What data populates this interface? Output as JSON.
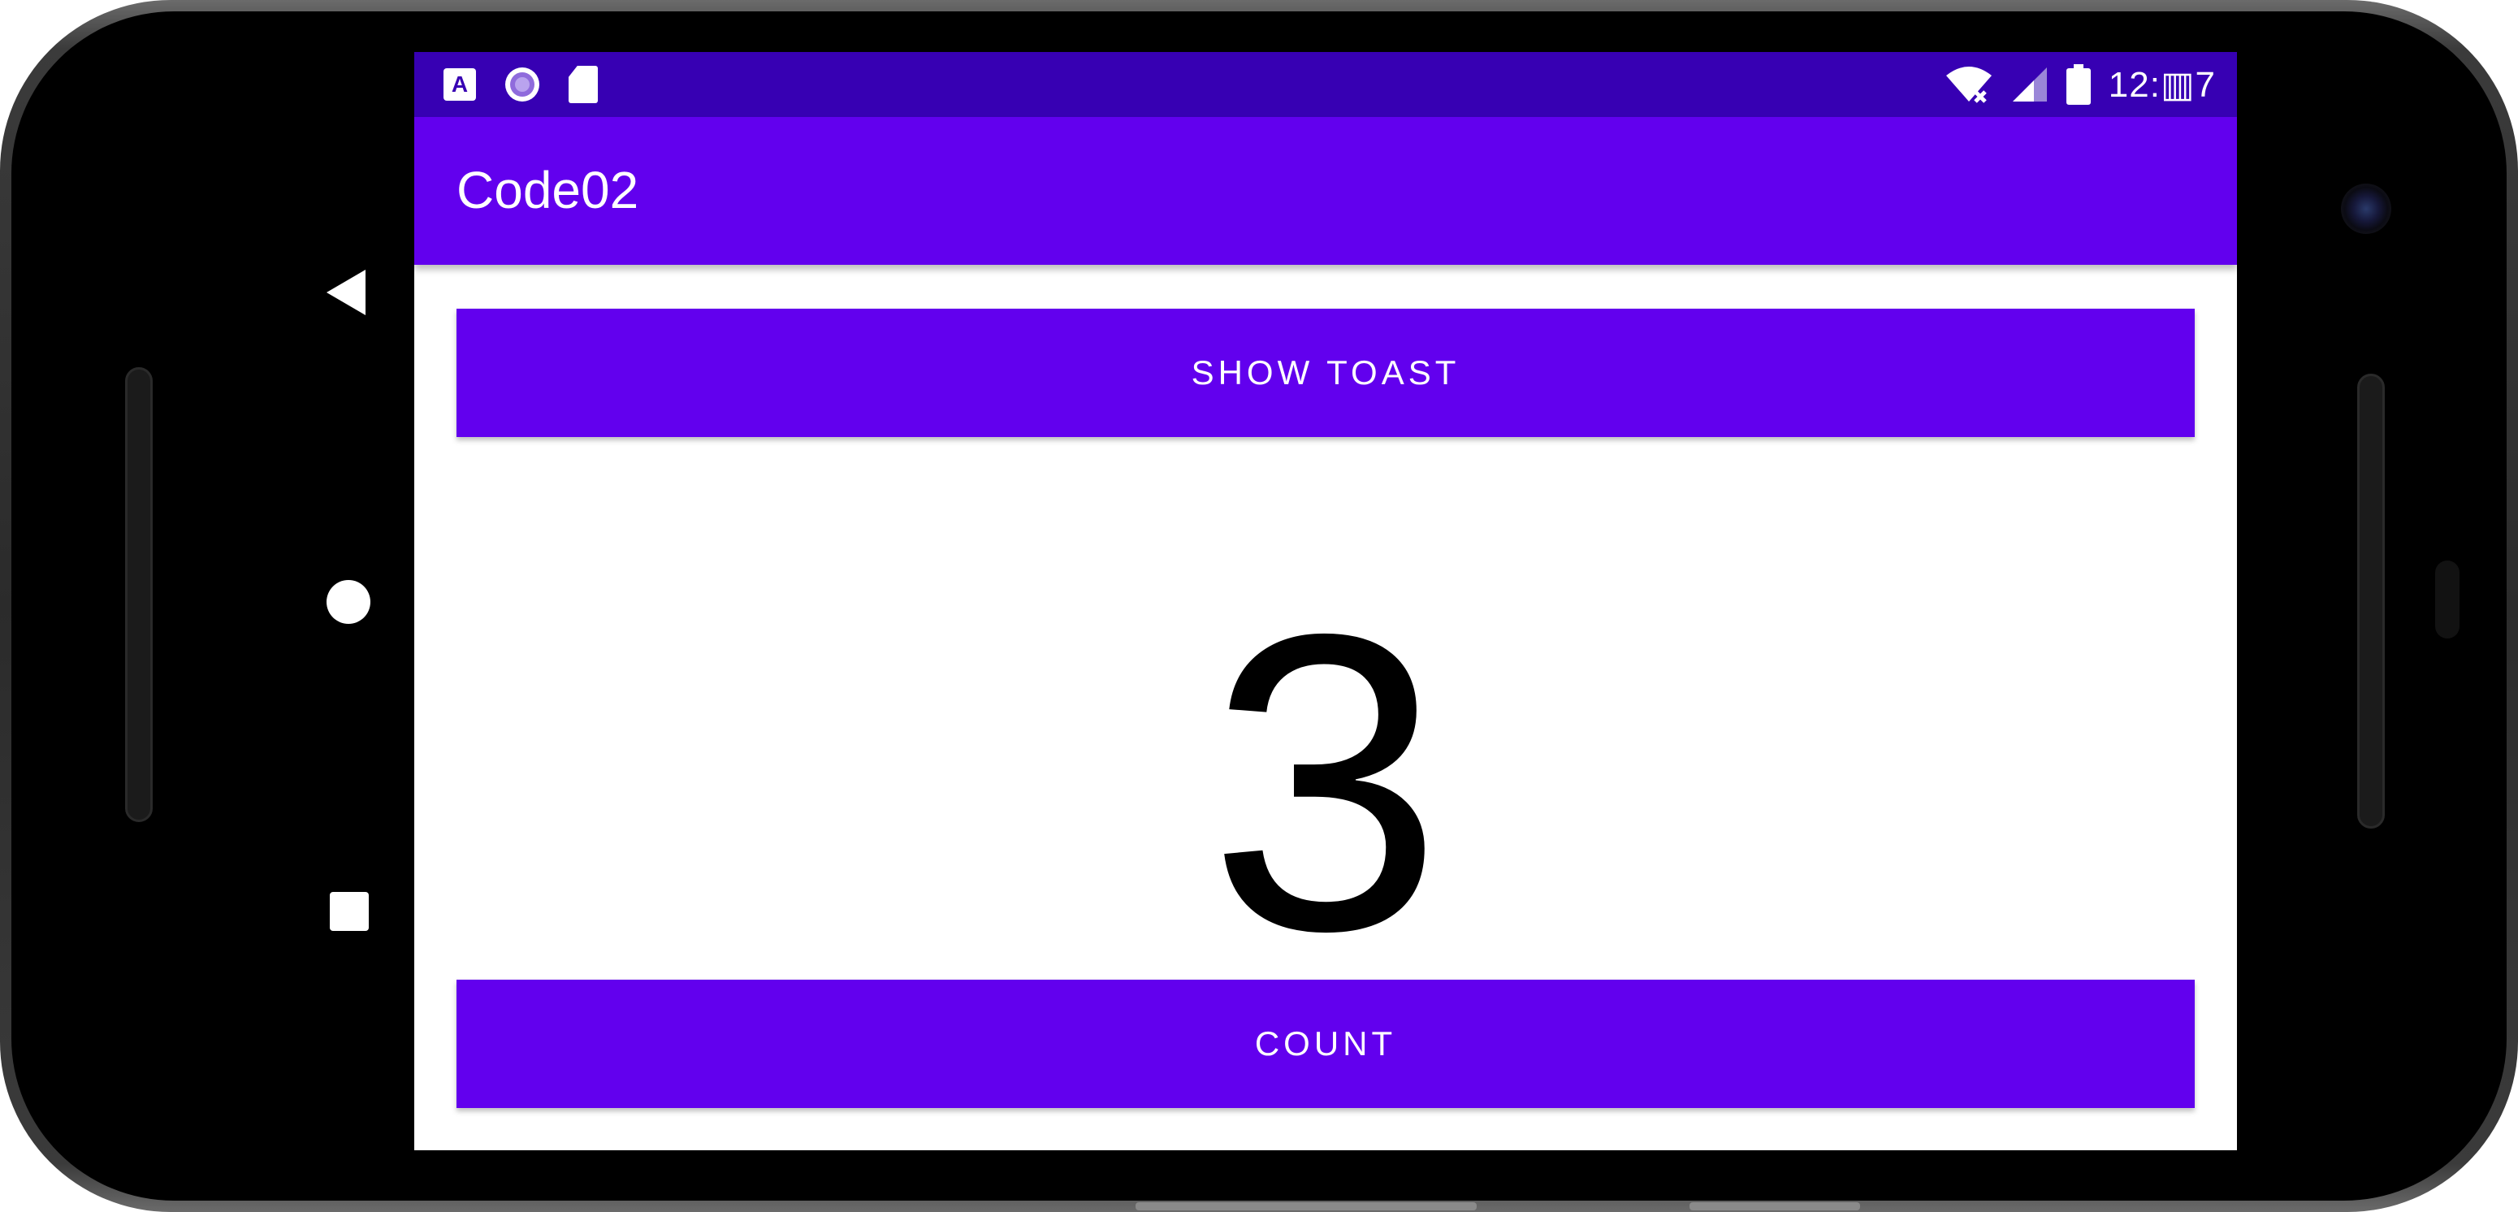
{
  "device": {
    "nav": {
      "back_icon": "back-triangle-icon",
      "home_icon": "home-circle-icon",
      "recents_icon": "recents-square-icon"
    }
  },
  "status_bar": {
    "left_icons": [
      "font-a-icon",
      "circle-app-icon",
      "sd-card-icon"
    ],
    "right_icons": [
      "wifi-no-internet-icon",
      "signal-icon",
      "battery-icon"
    ],
    "time": "12:▥7"
  },
  "app_bar": {
    "title": "Code02"
  },
  "main": {
    "toast_button_label": "SHOW TOAST",
    "count_value": "3",
    "count_button_label": "COUNT"
  },
  "colors": {
    "status_bar": "#3700b3",
    "primary": "#6200ee",
    "button_text": "#ffffff",
    "count_text": "#000000"
  }
}
